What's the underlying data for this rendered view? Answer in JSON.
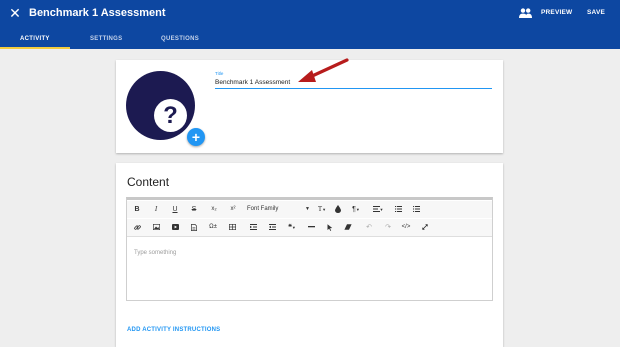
{
  "header": {
    "title": "Benchmark 1 Assessment",
    "preview_label": "PREVIEW",
    "save_label": "SAVE",
    "icons": {
      "close": "close-icon",
      "people": "people-icon"
    },
    "colors": {
      "bar": "#0d47a1",
      "tab_indicator": "#f3cd3e"
    }
  },
  "tabs": [
    {
      "label": "ACTIVITY",
      "active": true
    },
    {
      "label": "SETTINGS",
      "active": false
    },
    {
      "label": "QUESTIONS",
      "active": false
    }
  ],
  "activity_card": {
    "avatar_icon": "question-mark-icon",
    "add_icon": "plus-icon",
    "title_label": "Title",
    "title_value": "Benchmark 1 Assessment",
    "annotation": "red-arrow-pointing-to-title"
  },
  "content_card": {
    "heading": "Content",
    "toolbar": {
      "bold": "B",
      "italic": "I",
      "underline": "U",
      "strike": "S",
      "subscript": "x₂",
      "superscript": "x²",
      "font_family": "Font Family",
      "font_size": "T",
      "row1_icons": [
        "bold-icon",
        "italic-icon",
        "underline-icon",
        "strikethrough-icon",
        "subscript-icon",
        "superscript-icon",
        "font-family-select",
        "font-size-icon",
        "color-drop-icon",
        "paragraph-icon",
        "align-icon",
        "ordered-list-icon",
        "unordered-list-icon"
      ],
      "row2_icons": [
        "link-icon",
        "image-icon",
        "video-icon",
        "file-icon",
        "special-chars-icon",
        "table-icon",
        "outdent-icon",
        "indent-icon",
        "quote-icon",
        "horizontal-rule-icon",
        "select-all-icon",
        "clear-format-icon",
        "undo-icon",
        "redo-icon",
        "code-view-icon",
        "fullscreen-icon"
      ]
    },
    "placeholder": "Type something",
    "add_instructions_label": "ADD ACTIVITY INSTRUCTIONS"
  }
}
